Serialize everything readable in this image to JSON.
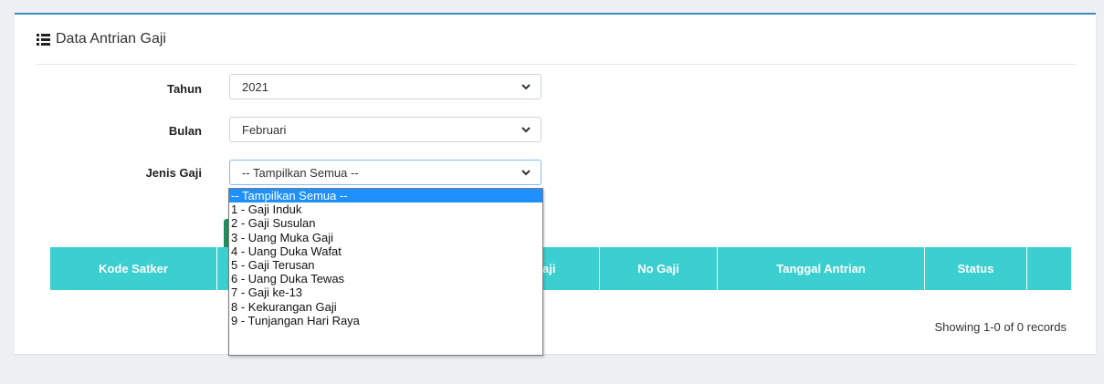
{
  "card": {
    "title": "Data Antrian Gaji",
    "icon": "list-icon"
  },
  "form": {
    "tahun": {
      "label": "Tahun",
      "value": "2021"
    },
    "bulan": {
      "label": "Bulan",
      "value": "Februari"
    },
    "jenis": {
      "label": "Jenis Gaji",
      "value": "-- Tampilkan Semua --"
    }
  },
  "dropdown_options": [
    "-- Tampilkan Semua --",
    "1 - Gaji Induk",
    "2 - Gaji Susulan",
    "3 - Uang Muka Gaji",
    "4 - Uang Duka Wafat",
    "5 - Gaji Terusan",
    "6 - Uang Duka Tewas",
    "7 - Gaji ke-13",
    "8 - Kekurangan Gaji",
    "9 - Tunjangan Hari Raya"
  ],
  "table": {
    "columns": [
      "Kode Satker",
      "",
      "aji",
      "No Gaji",
      "Tanggal Antrian",
      "Status",
      ""
    ]
  },
  "records_text": "Showing 1-0 of 0 records",
  "colors": {
    "accent_border": "#3c8dbc",
    "table_header": "#3ccfcf",
    "selected_option": "#1e90ff",
    "button_green": "#1e8e5a"
  }
}
